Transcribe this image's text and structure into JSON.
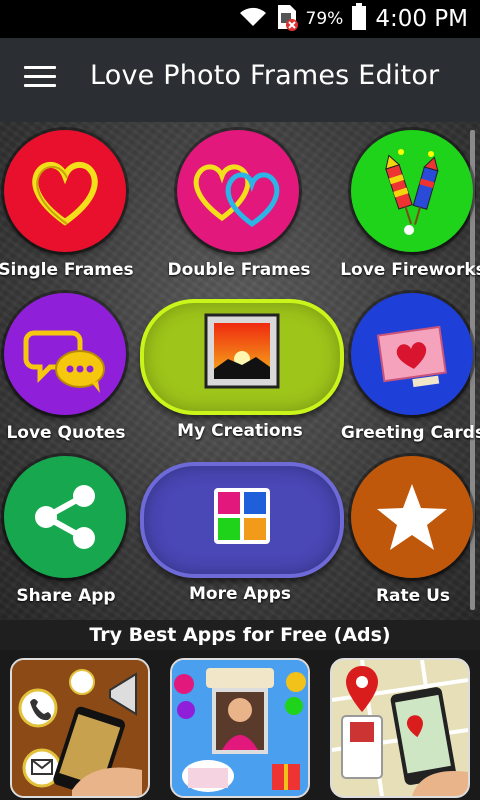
{
  "status_bar": {
    "battery_percent": "79%",
    "time": "4:00 PM",
    "icons": [
      "wifi-icon",
      "sim-error-icon",
      "battery-icon"
    ]
  },
  "app_bar": {
    "title": "Love Photo Frames Editor",
    "menu_icon": "hamburger-menu-icon"
  },
  "menu": [
    {
      "label": "Single Frames",
      "color": "#e8102d",
      "icon": "single-heart-icon"
    },
    {
      "label": "Double Frames",
      "color": "#e2187d",
      "icon": "double-heart-icon"
    },
    {
      "label": "Love Fireworks",
      "color": "#1ed31a",
      "icon": "fireworks-icon"
    },
    {
      "label": "Love Quotes",
      "color": "#8f1fd9",
      "icon": "speech-bubbles-icon"
    },
    {
      "label": "My Creations",
      "color": "#9ec51a",
      "icon": "gallery-photo-icon"
    },
    {
      "label": "Greeting Cards",
      "color": "#1f3fd9",
      "icon": "greeting-card-icon"
    },
    {
      "label": "Share App",
      "color": "#17a84f",
      "icon": "share-icon"
    },
    {
      "label": "More Apps",
      "color": "#4a47b6",
      "icon": "app-grid-icon"
    },
    {
      "label": "Rate Us",
      "color": "#c0580c",
      "icon": "star-icon"
    }
  ],
  "ads": {
    "heading": "Try Best Apps for Free (Ads)",
    "items": [
      {
        "icon": "caller-id-app-icon"
      },
      {
        "icon": "birthday-photo-frame-app-icon"
      },
      {
        "icon": "mobile-location-tracker-app-icon"
      }
    ]
  }
}
